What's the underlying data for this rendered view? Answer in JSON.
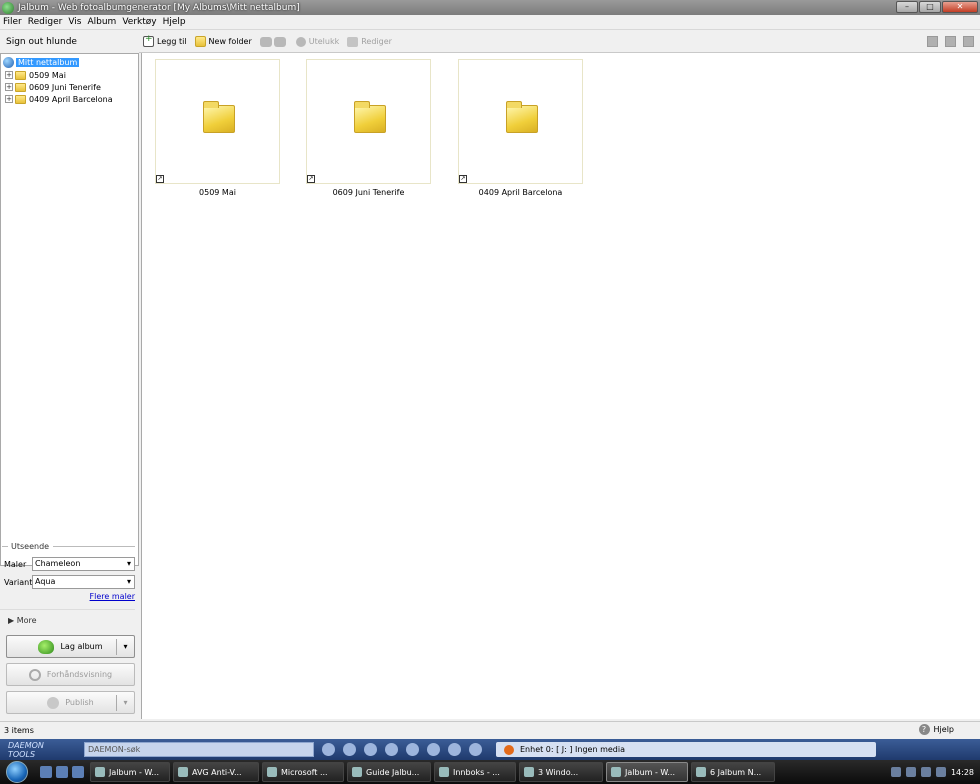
{
  "window": {
    "title": "Jalbum - Web fotoalbumgenerator [My Albums\\Mitt nettalbum]",
    "minimize": "–",
    "maximize": "□",
    "close": "✕"
  },
  "menu": [
    "Filer",
    "Rediger",
    "Vis",
    "Album",
    "Verktøy",
    "Hjelp"
  ],
  "sidebar": {
    "sign_out": "Sign out hlunde",
    "tree": {
      "root": "Mitt nettalbum",
      "items": [
        "0509 Mai",
        "0609 Juni Tenerife",
        "0409 April Barcelona"
      ]
    },
    "look_section": "Utseende",
    "skin_label": "Maler",
    "skin_value": "Chameleon",
    "variant_label": "Variant",
    "variant_value": "Aqua",
    "more_skins": "Flere maler",
    "more": "More",
    "make_album": "Lag album",
    "preview": "Forhåndsvisning",
    "publish": "Publish"
  },
  "toolbar": {
    "add": "Legg til",
    "new_folder": "New folder",
    "exclude": "Utelukk",
    "edit": "Rediger"
  },
  "folders": [
    "0509 Mai",
    "0609 Juni Tenerife",
    "0409 April Barcelona"
  ],
  "status": {
    "items": "3 items",
    "help": "Hjelp"
  },
  "daemon": {
    "logo": "DAEMON TOOLS",
    "search_placeholder": "DAEMON-søk",
    "device": "Enhet 0: [ J: ] Ingen media"
  },
  "taskbar": {
    "tasks": [
      "Jalbum - W...",
      "AVG Anti-V...",
      "Microsoft ...",
      "Guide Jalbu...",
      "Innboks - ...",
      "3 Windo...",
      "Jalbum - W...",
      "6 Jalbum N..."
    ],
    "active_index": 6,
    "clock": "14:28"
  }
}
